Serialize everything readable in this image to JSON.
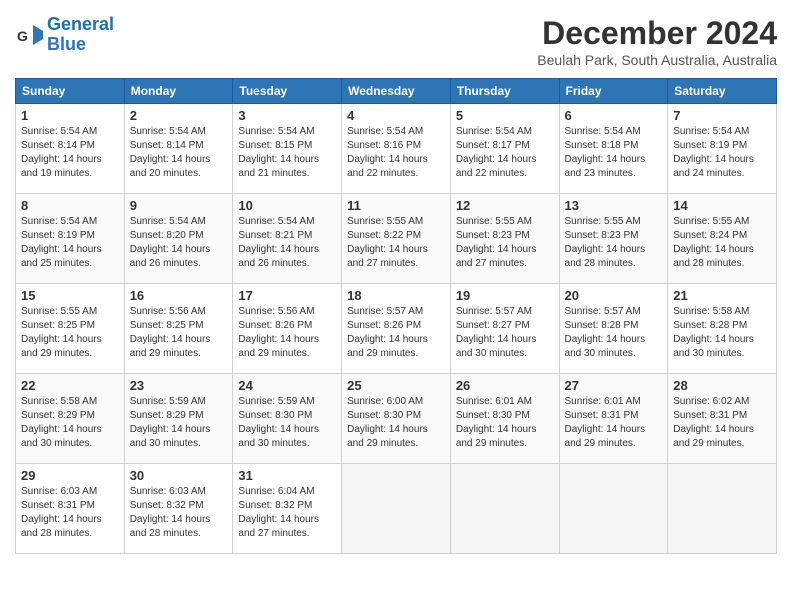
{
  "logo": {
    "line1": "General",
    "line2": "Blue"
  },
  "title": "December 2024",
  "location": "Beulah Park, South Australia, Australia",
  "days_of_week": [
    "Sunday",
    "Monday",
    "Tuesday",
    "Wednesday",
    "Thursday",
    "Friday",
    "Saturday"
  ],
  "weeks": [
    [
      {
        "day": "1",
        "sunrise": "Sunrise: 5:54 AM",
        "sunset": "Sunset: 8:14 PM",
        "daylight": "Daylight: 14 hours and 19 minutes."
      },
      {
        "day": "2",
        "sunrise": "Sunrise: 5:54 AM",
        "sunset": "Sunset: 8:14 PM",
        "daylight": "Daylight: 14 hours and 20 minutes."
      },
      {
        "day": "3",
        "sunrise": "Sunrise: 5:54 AM",
        "sunset": "Sunset: 8:15 PM",
        "daylight": "Daylight: 14 hours and 21 minutes."
      },
      {
        "day": "4",
        "sunrise": "Sunrise: 5:54 AM",
        "sunset": "Sunset: 8:16 PM",
        "daylight": "Daylight: 14 hours and 22 minutes."
      },
      {
        "day": "5",
        "sunrise": "Sunrise: 5:54 AM",
        "sunset": "Sunset: 8:17 PM",
        "daylight": "Daylight: 14 hours and 22 minutes."
      },
      {
        "day": "6",
        "sunrise": "Sunrise: 5:54 AM",
        "sunset": "Sunset: 8:18 PM",
        "daylight": "Daylight: 14 hours and 23 minutes."
      },
      {
        "day": "7",
        "sunrise": "Sunrise: 5:54 AM",
        "sunset": "Sunset: 8:19 PM",
        "daylight": "Daylight: 14 hours and 24 minutes."
      }
    ],
    [
      {
        "day": "8",
        "sunrise": "Sunrise: 5:54 AM",
        "sunset": "Sunset: 8:19 PM",
        "daylight": "Daylight: 14 hours and 25 minutes."
      },
      {
        "day": "9",
        "sunrise": "Sunrise: 5:54 AM",
        "sunset": "Sunset: 8:20 PM",
        "daylight": "Daylight: 14 hours and 26 minutes."
      },
      {
        "day": "10",
        "sunrise": "Sunrise: 5:54 AM",
        "sunset": "Sunset: 8:21 PM",
        "daylight": "Daylight: 14 hours and 26 minutes."
      },
      {
        "day": "11",
        "sunrise": "Sunrise: 5:55 AM",
        "sunset": "Sunset: 8:22 PM",
        "daylight": "Daylight: 14 hours and 27 minutes."
      },
      {
        "day": "12",
        "sunrise": "Sunrise: 5:55 AM",
        "sunset": "Sunset: 8:23 PM",
        "daylight": "Daylight: 14 hours and 27 minutes."
      },
      {
        "day": "13",
        "sunrise": "Sunrise: 5:55 AM",
        "sunset": "Sunset: 8:23 PM",
        "daylight": "Daylight: 14 hours and 28 minutes."
      },
      {
        "day": "14",
        "sunrise": "Sunrise: 5:55 AM",
        "sunset": "Sunset: 8:24 PM",
        "daylight": "Daylight: 14 hours and 28 minutes."
      }
    ],
    [
      {
        "day": "15",
        "sunrise": "Sunrise: 5:55 AM",
        "sunset": "Sunset: 8:25 PM",
        "daylight": "Daylight: 14 hours and 29 minutes."
      },
      {
        "day": "16",
        "sunrise": "Sunrise: 5:56 AM",
        "sunset": "Sunset: 8:25 PM",
        "daylight": "Daylight: 14 hours and 29 minutes."
      },
      {
        "day": "17",
        "sunrise": "Sunrise: 5:56 AM",
        "sunset": "Sunset: 8:26 PM",
        "daylight": "Daylight: 14 hours and 29 minutes."
      },
      {
        "day": "18",
        "sunrise": "Sunrise: 5:57 AM",
        "sunset": "Sunset: 8:26 PM",
        "daylight": "Daylight: 14 hours and 29 minutes."
      },
      {
        "day": "19",
        "sunrise": "Sunrise: 5:57 AM",
        "sunset": "Sunset: 8:27 PM",
        "daylight": "Daylight: 14 hours and 30 minutes."
      },
      {
        "day": "20",
        "sunrise": "Sunrise: 5:57 AM",
        "sunset": "Sunset: 8:28 PM",
        "daylight": "Daylight: 14 hours and 30 minutes."
      },
      {
        "day": "21",
        "sunrise": "Sunrise: 5:58 AM",
        "sunset": "Sunset: 8:28 PM",
        "daylight": "Daylight: 14 hours and 30 minutes."
      }
    ],
    [
      {
        "day": "22",
        "sunrise": "Sunrise: 5:58 AM",
        "sunset": "Sunset: 8:29 PM",
        "daylight": "Daylight: 14 hours and 30 minutes."
      },
      {
        "day": "23",
        "sunrise": "Sunrise: 5:59 AM",
        "sunset": "Sunset: 8:29 PM",
        "daylight": "Daylight: 14 hours and 30 minutes."
      },
      {
        "day": "24",
        "sunrise": "Sunrise: 5:59 AM",
        "sunset": "Sunset: 8:30 PM",
        "daylight": "Daylight: 14 hours and 30 minutes."
      },
      {
        "day": "25",
        "sunrise": "Sunrise: 6:00 AM",
        "sunset": "Sunset: 8:30 PM",
        "daylight": "Daylight: 14 hours and 29 minutes."
      },
      {
        "day": "26",
        "sunrise": "Sunrise: 6:01 AM",
        "sunset": "Sunset: 8:30 PM",
        "daylight": "Daylight: 14 hours and 29 minutes."
      },
      {
        "day": "27",
        "sunrise": "Sunrise: 6:01 AM",
        "sunset": "Sunset: 8:31 PM",
        "daylight": "Daylight: 14 hours and 29 minutes."
      },
      {
        "day": "28",
        "sunrise": "Sunrise: 6:02 AM",
        "sunset": "Sunset: 8:31 PM",
        "daylight": "Daylight: 14 hours and 29 minutes."
      }
    ],
    [
      {
        "day": "29",
        "sunrise": "Sunrise: 6:03 AM",
        "sunset": "Sunset: 8:31 PM",
        "daylight": "Daylight: 14 hours and 28 minutes."
      },
      {
        "day": "30",
        "sunrise": "Sunrise: 6:03 AM",
        "sunset": "Sunset: 8:32 PM",
        "daylight": "Daylight: 14 hours and 28 minutes."
      },
      {
        "day": "31",
        "sunrise": "Sunrise: 6:04 AM",
        "sunset": "Sunset: 8:32 PM",
        "daylight": "Daylight: 14 hours and 27 minutes."
      },
      null,
      null,
      null,
      null
    ]
  ]
}
